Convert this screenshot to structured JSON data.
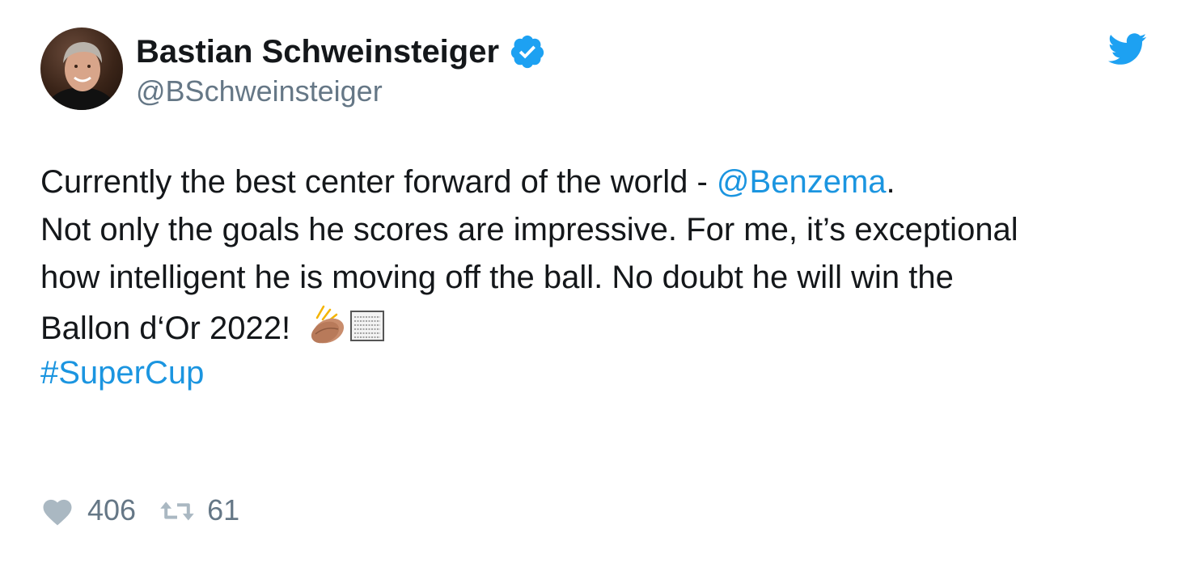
{
  "author": {
    "display_name": "Bastian Schweinsteiger",
    "handle": "@BSchweinsteiger",
    "verified": true,
    "avatar_icon": "avatar-photo"
  },
  "platform_icon": "twitter-bird-icon",
  "tweet": {
    "line1_text": "Currently the best center forward of the world - ",
    "line1_mention": "@Benzema",
    "line1_end": ".",
    "line2": "Not only the goals he scores are impressive. For me, it’s exceptional",
    "line3": "how intelligent he is moving off the ball. No doubt he will win the",
    "line4": "Ballon d‘Or 2022! ",
    "emojis": [
      "clapping-hands-emoji",
      "missing-glyph-box"
    ],
    "hashtag": "#SuperCup"
  },
  "stats": {
    "likes": "406",
    "retweets": "61"
  },
  "colors": {
    "text": "#14171a",
    "secondary": "#657786",
    "link": "#1b95e0",
    "verified": "#1da1f2",
    "icon_grey": "#aab8c2"
  }
}
